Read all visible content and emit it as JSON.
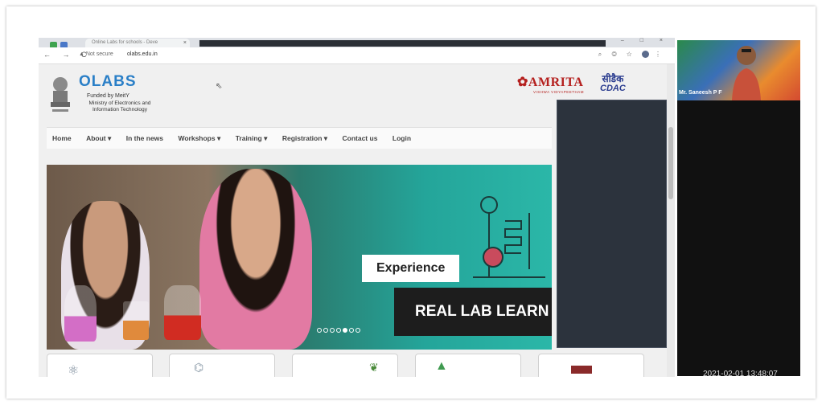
{
  "browser": {
    "tab_title": "Online Labs for schools - Deve",
    "tab_close": "×",
    "window_controls": "– □ ×",
    "nav_buttons": "← → C",
    "security_label": "▲ Not secure",
    "url": "olabs.edu.in",
    "toolbar_icons": "⌕ ◎ ☆"
  },
  "site": {
    "logo_text": "OLABS",
    "funded_by": "Funded by MeitY",
    "ministry_line1": "Ministry of Electronics and",
    "ministry_line2": "Information Technology",
    "partner1": "AMRITA",
    "partner1_sub": "VISHWA VIDYAPEETHAM",
    "partner2_hindi": "सीडैक",
    "partner2": "CDAC",
    "menu": [
      "Home",
      "About ▾",
      "In the news",
      "Workshops ▾",
      "Training ▾",
      "Registration ▾",
      "Contact us",
      "Login"
    ],
    "banner_heading": "Experience",
    "banner_subheading": "REAL LAB LEARN",
    "carousel_active_index": 4,
    "carousel_total": 7
  },
  "video": {
    "participant_name": "Mr. Saneesh P F",
    "timestamp": "2021-02-01  13:48:07"
  },
  "colors": {
    "olabs_blue": "#2a7fc7",
    "amrita_red": "#b5211f",
    "cdac_blue": "#2a3c8f"
  }
}
